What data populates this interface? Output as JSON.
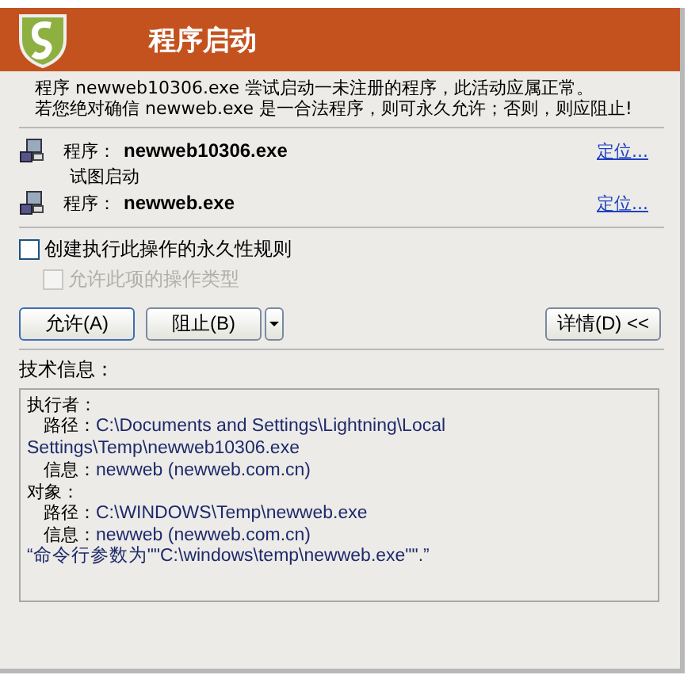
{
  "header": {
    "title": "程序启动"
  },
  "message": [
    "程序 newweb10306.exe 尝试启动一未注册的程序，此活动应属正常。",
    "若您绝对确信 newweb.exe 是一合法程序，则可永久允许；否则，则应阻止!"
  ],
  "programs": [
    {
      "label": "程序：",
      "name": "newweb10306.exe",
      "link": "定位..."
    },
    {
      "note": "试图启动",
      "label": "程序：",
      "name": "newweb.exe",
      "link": "定位..."
    }
  ],
  "options": [
    {
      "label": "创建执行此操作的永久性规则",
      "checked": false,
      "disabled": false
    },
    {
      "label": "允许此项的操作类型",
      "checked": false,
      "disabled": true
    }
  ],
  "buttons": [
    {
      "label": "允许(A)",
      "kind": "default"
    },
    {
      "label": "阻止(B)",
      "kind": "plain"
    },
    {
      "kind": "dropdown"
    },
    {
      "label": "详情(D) <<",
      "kind": "details"
    }
  ],
  "tech_info": {
    "title": "技术信息：",
    "lines": [
      {
        "kind": "heading",
        "label": "执行者："
      },
      {
        "kind": "field",
        "label": "路径：",
        "value": "C:\\Documents and Settings\\Lightning\\Local Settings\\Temp\\newweb10306.exe"
      },
      {
        "kind": "field",
        "label": "信息：",
        "value": "newweb (newweb.com.cn)"
      },
      {
        "kind": "heading",
        "label": "对象："
      },
      {
        "kind": "field",
        "label": "路径：",
        "value": "C:\\WINDOWS\\Temp\\newweb.exe"
      },
      {
        "kind": "field",
        "label": "信息：",
        "value": "newweb (newweb.com.cn)"
      },
      {
        "kind": "plain",
        "value": "“命令行参数为\"\"C:\\windows\\temp\\newweb.exe\"\".”"
      }
    ]
  }
}
